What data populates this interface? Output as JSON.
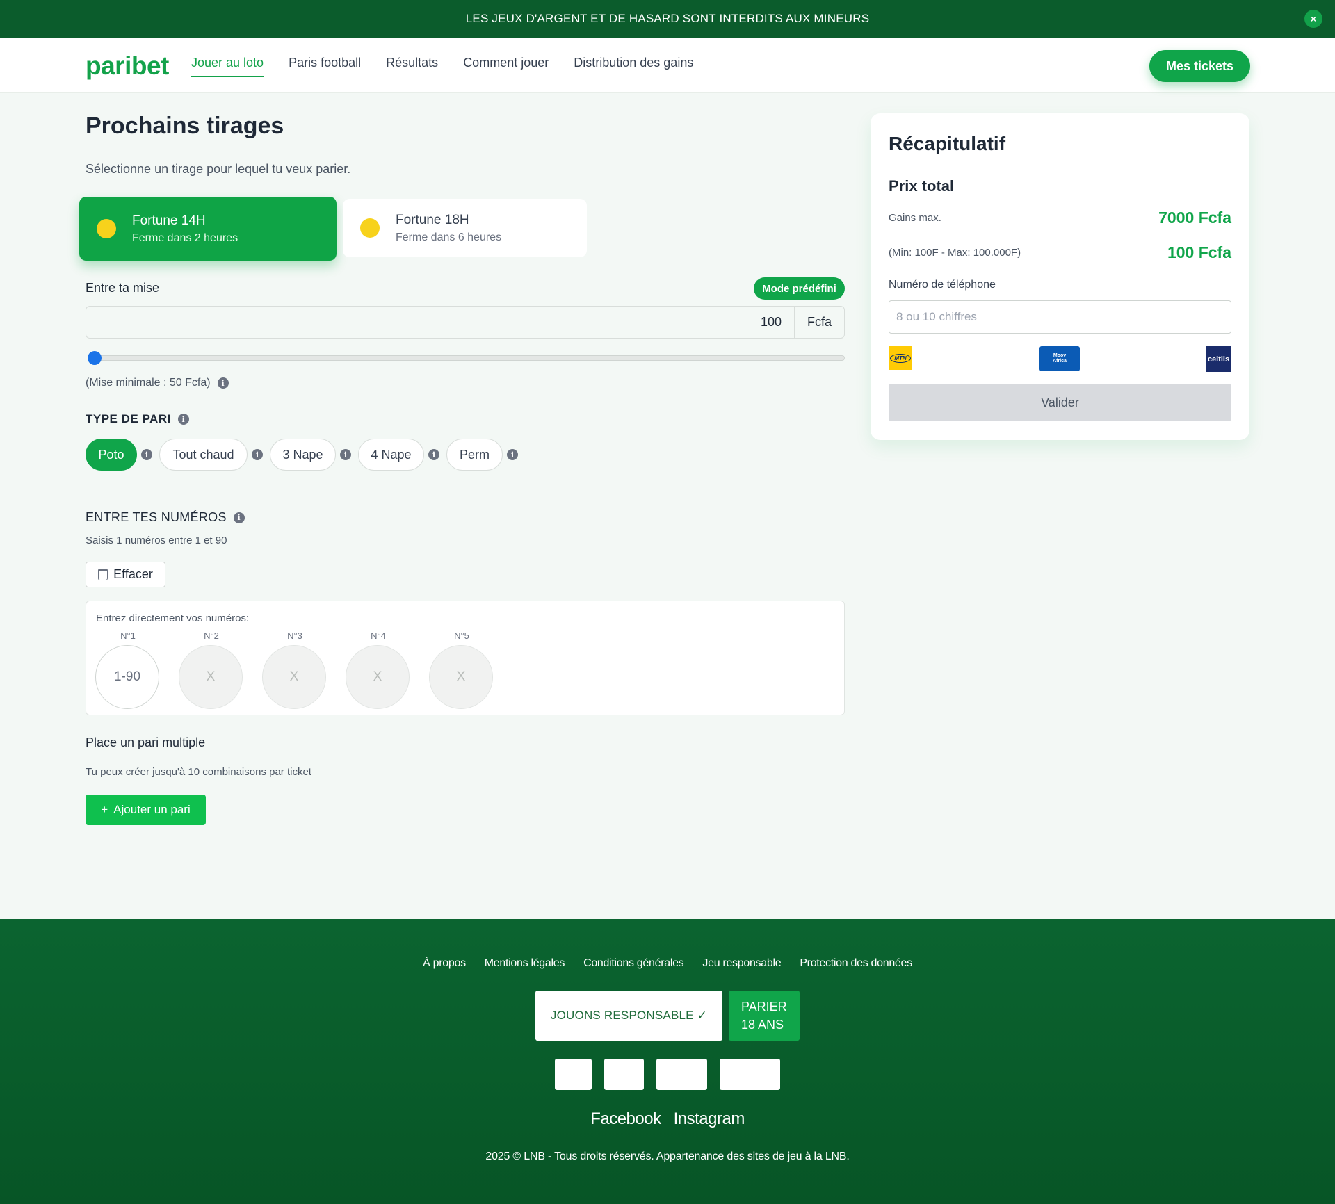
{
  "banner": {
    "text": "LES JEUX D'ARGENT ET DE HASARD SONT INTERDITS AUX MINEURS",
    "close": "×"
  },
  "header": {
    "logo": "paribet",
    "nav": [
      "Jouer au loto",
      "Paris football",
      "Résultats",
      "Comment jouer",
      "Distribution des gains"
    ],
    "tickets_button": "Mes tickets"
  },
  "main": {
    "title": "Prochains tirages",
    "subtitle": "Sélectionne un tirage pour lequel tu veux parier.",
    "draws": [
      {
        "name": "Fortune 14H",
        "status": "Ferme dans 2 heures",
        "selected": true
      },
      {
        "name": "Fortune 18H",
        "status": "Ferme dans 6 heures",
        "selected": false
      }
    ],
    "stake": {
      "label": "Entre ta mise",
      "mode_button": "Mode prédéfini",
      "value": "100",
      "unit": "Fcfa",
      "slider_fraction": 0.0,
      "min_note": "(Mise minimale : 50 Fcfa)"
    },
    "bet_type": {
      "title": "TYPE DE PARI",
      "options": [
        "Poto",
        "Tout chaud",
        "3 Nape",
        "4 Nape",
        "Perm"
      ],
      "selected": "Poto"
    },
    "numbers": {
      "title": "ENTRE TES NUMÉROS",
      "subtitle": "Saisis 1 numéros entre 1 et 90",
      "clear_button": "Effacer",
      "box_label": "Entrez directement vos numéros:",
      "slots": [
        {
          "label": "N°1",
          "placeholder": "1-90"
        },
        {
          "label": "N°2",
          "placeholder": "X"
        },
        {
          "label": "N°3",
          "placeholder": "X"
        },
        {
          "label": "N°4",
          "placeholder": "X"
        },
        {
          "label": "N°5",
          "placeholder": "X"
        }
      ]
    },
    "multiple": {
      "title": "Place un pari multiple",
      "subtitle": "Tu peux créer jusqu'à 10 combinaisons par ticket",
      "add_button": "Ajouter un pari",
      "add_icon": "+"
    }
  },
  "summary": {
    "title": "Récapitulatif",
    "total_label": "Prix total",
    "max_gain_label": "Gains max.",
    "max_gain_value": "7000 Fcfa",
    "range_label": "(Min: 100F - Max: 100.000F)",
    "price_value": "100 Fcfa",
    "phone_label": "Numéro de téléphone",
    "phone_placeholder": "8 ou 10 chiffres",
    "operators": {
      "mtn": "MTN",
      "moov_line1": "Moov",
      "moov_line2": "Africa",
      "celtiis": "celtiis"
    },
    "validate_button": "Valider"
  },
  "footer": {
    "links": [
      "À propos",
      "Mentions légales",
      "Conditions générales",
      "Jeu responsable",
      "Protection des données"
    ],
    "responsible_badge": "JOUONS RESPONSABLE ✓",
    "age_line1": "PARIER",
    "age_line2": "18 ANS",
    "social": [
      "Facebook",
      "Instagram"
    ],
    "copyright": "2025 © LNB - Tous droits réservés. Appartenance des sites de jeu à la LNB."
  },
  "colors": {
    "brand_green": "#10a54a",
    "banner_green": "#0b5c2c",
    "draw_dot_yellow": "#f7d21c",
    "slider_blue": "#1a73e8"
  },
  "icons": [
    "close-icon",
    "info-icon",
    "trash-icon",
    "plus-icon"
  ]
}
